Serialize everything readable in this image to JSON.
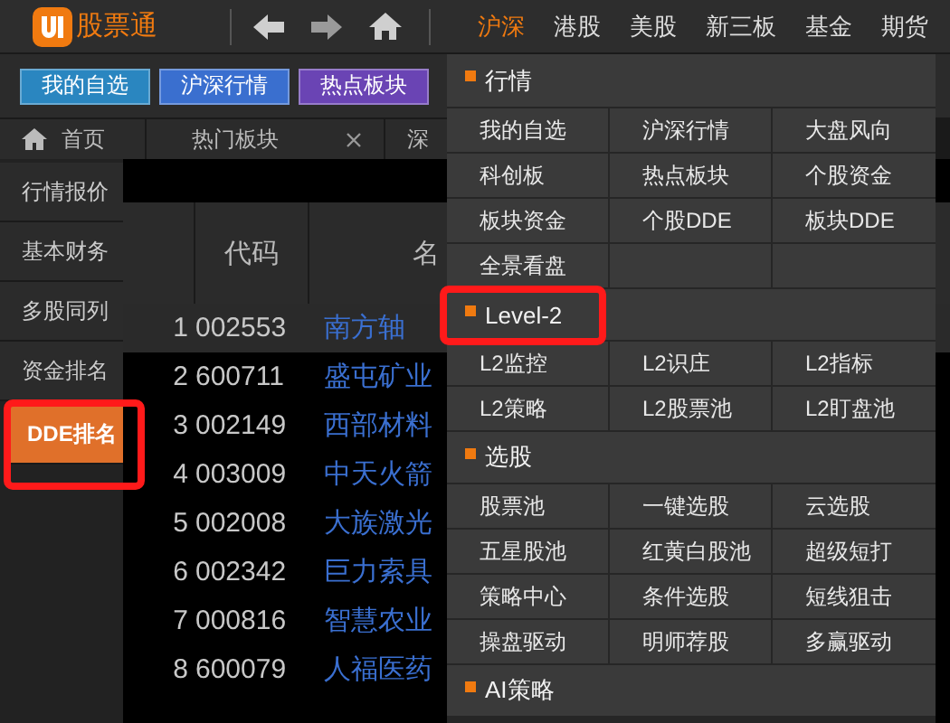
{
  "app": {
    "name": "股票通"
  },
  "markets": [
    {
      "label": "沪深",
      "selected": true
    },
    {
      "label": "港股",
      "selected": false
    },
    {
      "label": "美股",
      "selected": false
    },
    {
      "label": "新三板",
      "selected": false
    },
    {
      "label": "基金",
      "selected": false
    },
    {
      "label": "期货",
      "selected": false
    }
  ],
  "quick_buttons": [
    {
      "label": "我的自选",
      "color": "#2a86c0"
    },
    {
      "label": "沪深行情",
      "color": "#3a6fcf"
    },
    {
      "label": "热点板块",
      "color": "#6a44b4"
    }
  ],
  "tabs": [
    {
      "label": "首页",
      "kind": "home",
      "closable": false
    },
    {
      "label": "热门板块",
      "kind": "page",
      "closable": true
    },
    {
      "label": "深",
      "kind": "page",
      "closable": false
    }
  ],
  "sidebar": {
    "items": [
      {
        "label": "行情报价",
        "selected": false,
        "highlighted": false
      },
      {
        "label": "基本财务",
        "selected": false,
        "highlighted": false
      },
      {
        "label": "多股同列",
        "selected": false,
        "highlighted": false
      },
      {
        "label": "资金排名",
        "selected": false,
        "highlighted": false
      },
      {
        "label": "DDE排名",
        "selected": true,
        "highlighted": true
      }
    ]
  },
  "table": {
    "columns": [
      "代码",
      "名"
    ],
    "rows": [
      {
        "index": "1",
        "code": "002553",
        "name": "南方轴",
        "selected": true
      },
      {
        "index": "2",
        "code": "600711",
        "name": "盛屯矿业",
        "selected": false
      },
      {
        "index": "3",
        "code": "002149",
        "name": "西部材料",
        "selected": false
      },
      {
        "index": "4",
        "code": "003009",
        "name": "中天火箭",
        "selected": false
      },
      {
        "index": "5",
        "code": "002008",
        "name": "大族激光",
        "selected": false
      },
      {
        "index": "6",
        "code": "002342",
        "name": "巨力索具",
        "selected": false
      },
      {
        "index": "7",
        "code": "000816",
        "name": "智慧农业",
        "selected": false
      },
      {
        "index": "8",
        "code": "600079",
        "name": "人福医药",
        "selected": false
      }
    ]
  },
  "menu": {
    "sections": [
      {
        "title": "行情",
        "highlighted": false,
        "items": [
          "我的自选",
          "沪深行情",
          "大盘风向",
          "科创板",
          "热点板块",
          "个股资金",
          "板块资金",
          "个股DDE",
          "板块DDE",
          "全景看盘"
        ]
      },
      {
        "title": "Level-2",
        "highlighted": true,
        "items": [
          "L2监控",
          "L2识庄",
          "L2指标",
          "L2策略",
          "L2股票池",
          "L2盯盘池"
        ]
      },
      {
        "title": "选股",
        "highlighted": false,
        "items": [
          "股票池",
          "一键选股",
          "云选股",
          "五星股池",
          "红黄白股池",
          "超级短打",
          "策略中心",
          "条件选股",
          "短线狙击",
          "操盘驱动",
          "明师荐股",
          "多赢驱动"
        ]
      },
      {
        "title": "AI策略",
        "highlighted": false
      }
    ]
  }
}
